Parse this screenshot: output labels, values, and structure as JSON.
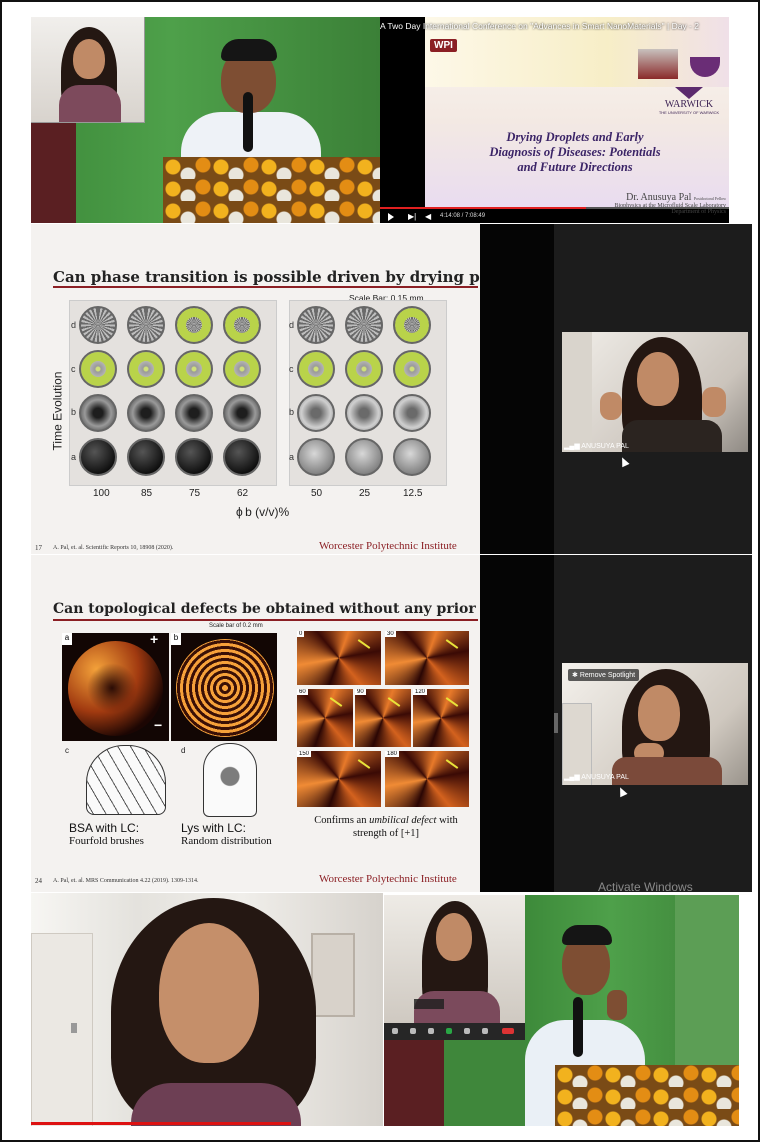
{
  "top_video": {
    "player_title": "A Two Day International Conference on \"Advances in Smart NanoMaterials\" | Day - 2",
    "time": "4:14:08 / 7:08:49",
    "logo_left": "WPI",
    "logo_right": "WARWICK",
    "logo_right_sub": "THE UNIVERSITY OF WARWICK",
    "talk_title_line1": "Drying Droplets and Early",
    "talk_title_line2": "Diagnosis of Diseases: Potentials",
    "talk_title_line3": "and Future Directions",
    "speaker": "Dr. Anusuya Pal",
    "speaker_affil1": "Postdoctoral Fellow",
    "speaker_affil2": "Biophysics at the Microfluid Scale Laboratory",
    "speaker_affil3": "Department of Physics"
  },
  "slide1": {
    "title": "Can phase transition is possible driven by drying process?",
    "scale_bar": "Scale Bar: 0.15 mm",
    "y_axis": "Time Evolution",
    "x_axis": "ϕ b (v/v)%",
    "rows": [
      "d",
      "c",
      "b",
      "a"
    ],
    "cols_left": [
      "100",
      "85",
      "75",
      "62"
    ],
    "cols_right": [
      "50",
      "25",
      "12.5"
    ],
    "page": "17",
    "citation": "A. Pal, et. al. Scientific Reports 10, 18908 (2020).",
    "institute": "Worcester Polytechnic Institute"
  },
  "slide2": {
    "title": "Can topological defects be obtained without any prior alignment?",
    "scale_bar": "Scale bar of 0.2 mm",
    "panel_a": "a",
    "panel_b": "b",
    "panel_c": "c",
    "panel_d": "d",
    "plus": "+",
    "minus": "−",
    "bsa_label": "BSA with LC:",
    "bsa_sub": "Fourfold brushes",
    "lys_label": "Lys with LC:",
    "lys_sub": "Random distribution",
    "umbilical_line1_pre": "Confirms an ",
    "umbilical_line1_em": "umbilical defect",
    "umbilical_line1_post": " with",
    "umbilical_line2": "strength of [+1]",
    "angles": [
      "0",
      "30",
      "60",
      "90",
      "120",
      "150",
      "180"
    ],
    "page": "24",
    "citation": "A. Pal, et. al. MRS Communication 4.22 (2019). 1309-1314.",
    "institute": "Worcester Polytechnic Institute"
  },
  "participant_tile1": {
    "name": "ANUSUYA PAL"
  },
  "participant_tile2": {
    "name": "ANUSUYA PAL",
    "menu": "Remove Spotlight"
  },
  "watermark": "Activate Windows"
}
